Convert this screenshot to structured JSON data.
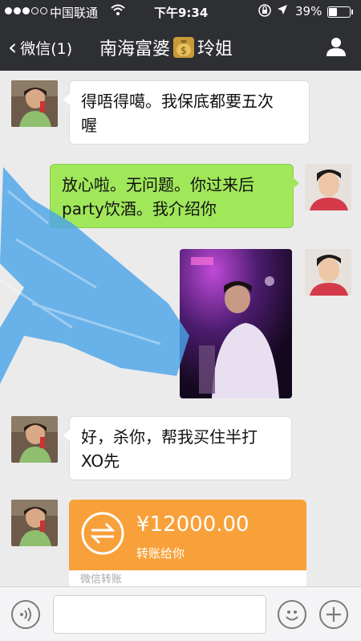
{
  "status_bar": {
    "carrier": "中国联通",
    "time": "下午9:34",
    "battery_percent": "39%",
    "battery_level": 0.39,
    "signal_strength": 3,
    "icons": [
      "wifi-icon",
      "lock-rotation-icon",
      "location-arrow-icon",
      "battery-icon"
    ]
  },
  "nav": {
    "back_label": "微信(1)",
    "title_left": "南海富婆",
    "title_right": "玲姐",
    "title_emoji": "money-bag-icon",
    "right_icon": "person-icon"
  },
  "messages": [
    {
      "side": "left",
      "type": "text",
      "lines": [
        "得唔得噶。我保底都要五次",
        "喔"
      ]
    },
    {
      "side": "right",
      "type": "text",
      "lines": [
        "放心啦。无问题。你过来后",
        "party饮酒。我介绍你"
      ]
    },
    {
      "side": "right",
      "type": "image"
    },
    {
      "side": "left",
      "type": "text",
      "lines": [
        "好，杀你，帮我买住半打",
        "XO先"
      ]
    },
    {
      "side": "left",
      "type": "transfer"
    }
  ],
  "transfer": {
    "amount": "¥12000.00",
    "subtitle": "转账给你",
    "footer": "微信转账",
    "icon": "transfer-arrows-icon"
  },
  "input_bar": {
    "voice_icon": "voice-icon",
    "emoji_icon": "emoji-icon",
    "plus_icon": "plus-icon",
    "placeholder": ""
  },
  "colors": {
    "topbar": "#2e2f33",
    "chat_bg": "#ebebeb",
    "green_bubble": "#a0e75a",
    "transfer_orange": "#f8a03a",
    "scribble_blue": "#4aa3e8"
  }
}
